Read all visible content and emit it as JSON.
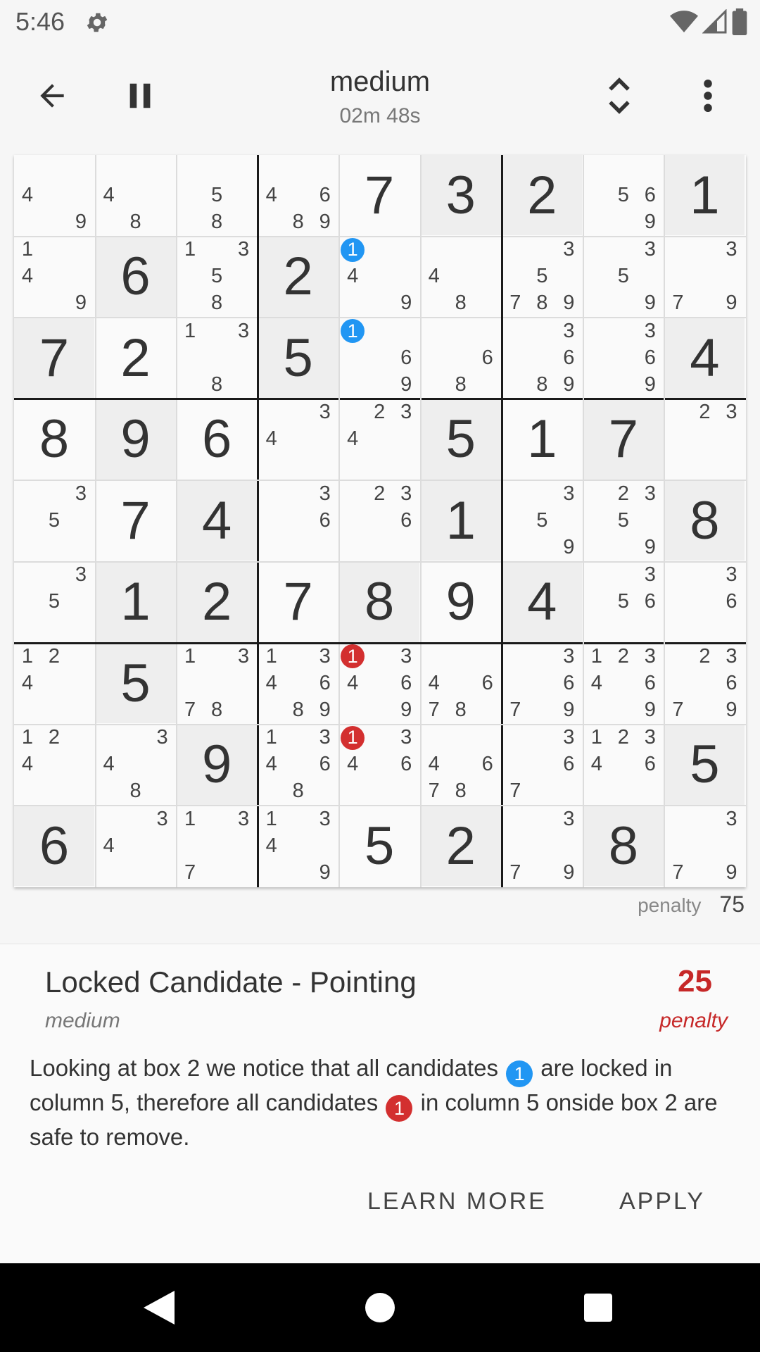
{
  "status_bar": {
    "time": "5:46"
  },
  "header": {
    "difficulty": "medium",
    "timer": "02m 48s",
    "icons": [
      "back-arrow-icon",
      "pause-icon",
      "expand-collapse-icon",
      "more-vertical-icon"
    ]
  },
  "board": {
    "values": [
      [
        0,
        0,
        0,
        0,
        7,
        3,
        2,
        0,
        1
      ],
      [
        0,
        6,
        0,
        2,
        0,
        0,
        0,
        0,
        0
      ],
      [
        7,
        2,
        0,
        5,
        0,
        0,
        0,
        0,
        4
      ],
      [
        8,
        9,
        6,
        0,
        0,
        5,
        1,
        7,
        0
      ],
      [
        0,
        7,
        4,
        0,
        0,
        1,
        0,
        0,
        8
      ],
      [
        0,
        1,
        2,
        7,
        8,
        9,
        4,
        0,
        0
      ],
      [
        0,
        5,
        0,
        0,
        0,
        0,
        0,
        0,
        0
      ],
      [
        0,
        0,
        9,
        0,
        0,
        0,
        0,
        0,
        5
      ],
      [
        6,
        0,
        0,
        0,
        5,
        2,
        0,
        8,
        0
      ]
    ],
    "givens": [
      [
        0,
        0,
        0,
        0,
        0,
        1,
        1,
        0,
        1
      ],
      [
        0,
        1,
        0,
        1,
        0,
        0,
        0,
        0,
        0
      ],
      [
        1,
        0,
        0,
        1,
        0,
        0,
        0,
        0,
        1
      ],
      [
        0,
        1,
        0,
        0,
        0,
        1,
        0,
        1,
        0
      ],
      [
        0,
        0,
        1,
        0,
        0,
        1,
        0,
        0,
        1
      ],
      [
        0,
        1,
        1,
        0,
        1,
        0,
        1,
        0,
        0
      ],
      [
        0,
        1,
        0,
        0,
        0,
        0,
        0,
        0,
        0
      ],
      [
        0,
        0,
        1,
        0,
        0,
        0,
        0,
        0,
        1
      ],
      [
        1,
        0,
        0,
        0,
        0,
        1,
        0,
        1,
        0
      ]
    ],
    "candidates": [
      [
        [
          4,
          9
        ],
        [
          4,
          8
        ],
        [
          5,
          8
        ],
        [
          4,
          6,
          8,
          9
        ],
        [],
        [],
        [],
        [
          5,
          6,
          9
        ],
        []
      ],
      [
        [
          1,
          4,
          9
        ],
        [],
        [
          1,
          3,
          5,
          8
        ],
        [],
        [
          1,
          4,
          9
        ],
        [
          4,
          8
        ],
        [
          3,
          5,
          7,
          8,
          9
        ],
        [
          3,
          5,
          9
        ],
        [
          3,
          7,
          9
        ]
      ],
      [
        [],
        [],
        [
          1,
          3,
          8
        ],
        [],
        [
          1,
          6,
          9
        ],
        [
          6,
          8
        ],
        [
          3,
          6,
          8,
          9
        ],
        [
          3,
          6,
          9
        ],
        []
      ],
      [
        [],
        [],
        [],
        [
          3,
          4
        ],
        [
          2,
          3,
          4
        ],
        [],
        [],
        [],
        [
          2,
          3
        ]
      ],
      [
        [
          3,
          5
        ],
        [],
        [],
        [
          3,
          6
        ],
        [
          2,
          3,
          6
        ],
        [],
        [
          3,
          5,
          9
        ],
        [
          2,
          3,
          5,
          9
        ],
        []
      ],
      [
        [
          3,
          5
        ],
        [],
        [],
        [],
        [],
        [],
        [],
        [
          3,
          5,
          6
        ],
        [
          3,
          6
        ]
      ],
      [
        [
          1,
          2,
          4
        ],
        [],
        [
          1,
          3,
          7,
          8
        ],
        [
          1,
          3,
          4,
          6,
          8,
          9
        ],
        [
          1,
          3,
          4,
          6,
          9
        ],
        [
          4,
          6,
          7,
          8
        ],
        [
          3,
          6,
          7,
          9
        ],
        [
          1,
          2,
          3,
          4,
          6,
          9
        ],
        [
          2,
          3,
          6,
          7,
          9
        ]
      ],
      [
        [
          1,
          2,
          4
        ],
        [
          3,
          4,
          8
        ],
        [],
        [
          1,
          3,
          4,
          6,
          8
        ],
        [
          1,
          3,
          4,
          6
        ],
        [
          4,
          6,
          7,
          8
        ],
        [
          3,
          6,
          7
        ],
        [
          1,
          2,
          3,
          4,
          6
        ],
        []
      ],
      [
        [],
        [
          3,
          4
        ],
        [
          1,
          3,
          7
        ],
        [
          1,
          3,
          4,
          9
        ],
        [],
        [],
        [
          3,
          7,
          9
        ],
        [],
        [
          3,
          7,
          9
        ]
      ]
    ],
    "highlights": [
      {
        "row": 1,
        "col": 4,
        "digit": 1,
        "color": "#2196f3"
      },
      {
        "row": 2,
        "col": 4,
        "digit": 1,
        "color": "#2196f3"
      },
      {
        "row": 6,
        "col": 4,
        "digit": 1,
        "color": "#d32f2f"
      },
      {
        "row": 7,
        "col": 4,
        "digit": 1,
        "color": "#d32f2f"
      }
    ]
  },
  "penalty": {
    "label": "penalty",
    "value": "75"
  },
  "hint": {
    "title": "Locked Candidate - Pointing",
    "level": "medium",
    "penalty_value": "25",
    "penalty_label": "penalty",
    "text_part1": "Looking at box 2 we notice that all candidates",
    "badge1": "1",
    "text_part2": "are locked in column 5, therefore all candidates",
    "badge2": "1",
    "text_part3": "in column 5 onside box 2 are safe to remove.",
    "learn_more": "LEARN MORE",
    "apply": "APPLY"
  },
  "nav": {
    "icons": [
      "back-triangle-icon",
      "home-circle-icon",
      "recents-square-icon"
    ]
  }
}
